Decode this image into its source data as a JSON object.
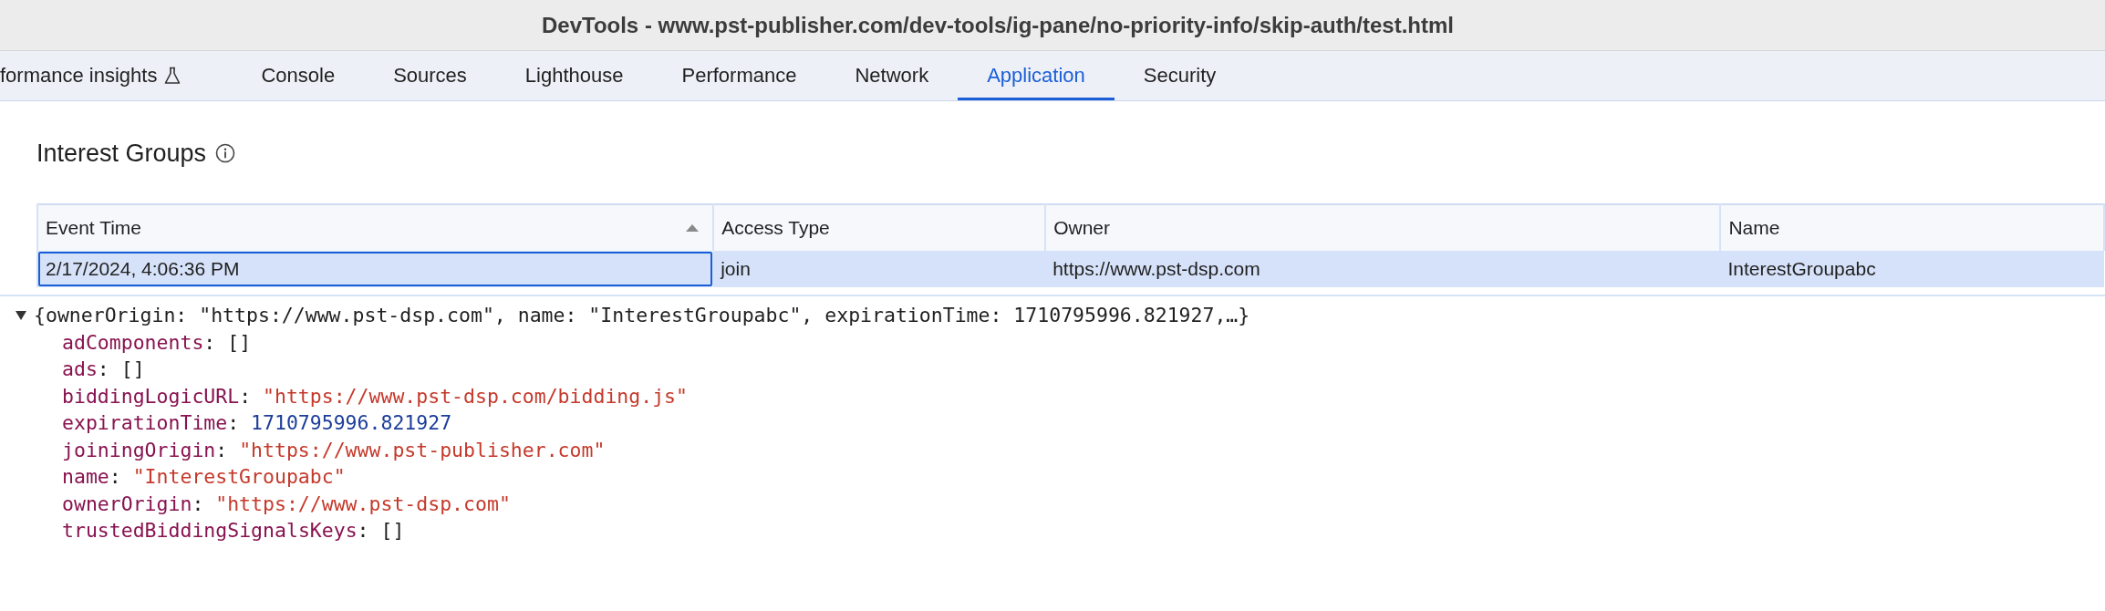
{
  "window": {
    "title": "DevTools - www.pst-publisher.com/dev-tools/ig-pane/no-priority-info/skip-auth/test.html"
  },
  "tabs": [
    {
      "label": "formance insights",
      "kind": "experimental",
      "selected": false
    },
    {
      "label": "Console",
      "kind": "plain",
      "selected": false
    },
    {
      "label": "Sources",
      "kind": "plain",
      "selected": false
    },
    {
      "label": "Lighthouse",
      "kind": "plain",
      "selected": false
    },
    {
      "label": "Performance",
      "kind": "plain",
      "selected": false
    },
    {
      "label": "Network",
      "kind": "plain",
      "selected": false
    },
    {
      "label": "Application",
      "kind": "plain",
      "selected": true
    },
    {
      "label": "Security",
      "kind": "plain",
      "selected": false
    }
  ],
  "section": {
    "title": "Interest Groups"
  },
  "table": {
    "columns": [
      {
        "label": "Event Time",
        "sorted_ascending": true
      },
      {
        "label": "Access Type",
        "sorted_ascending": false
      },
      {
        "label": "Owner",
        "sorted_ascending": false
      },
      {
        "label": "Name",
        "sorted_ascending": false
      }
    ],
    "rows": [
      {
        "selected": true,
        "cells": [
          {
            "text": "2/17/2024, 4:06:36 PM",
            "focused": true
          },
          {
            "text": "join",
            "focused": false
          },
          {
            "text": "https://www.pst-dsp.com",
            "focused": false
          },
          {
            "text": "InterestGroupabc",
            "focused": false
          }
        ]
      }
    ]
  },
  "details": {
    "expanded": true,
    "summary": "{ownerOrigin: \"https://www.pst-dsp.com\", name: \"InterestGroupabc\", expirationTime: 1710795996.821927,…}",
    "properties": [
      {
        "key": "adComponents",
        "separator": ":",
        "value": "[]",
        "kind": "array"
      },
      {
        "key": "ads",
        "separator": ":",
        "value": "[]",
        "kind": "array"
      },
      {
        "key": "biddingLogicURL",
        "separator": ":",
        "value": "\"https://www.pst-dsp.com/bidding.js\"",
        "kind": "string"
      },
      {
        "key": "expirationTime",
        "separator": ":",
        "value": "1710795996.821927",
        "kind": "number"
      },
      {
        "key": "joiningOrigin",
        "separator": ":",
        "value": "\"https://www.pst-publisher.com\"",
        "kind": "string"
      },
      {
        "key": "name",
        "separator": ":",
        "value": "\"InterestGroupabc\"",
        "kind": "string"
      },
      {
        "key": "ownerOrigin",
        "separator": ":",
        "value": "\"https://www.pst-dsp.com\"",
        "kind": "string"
      },
      {
        "key": "trustedBiddingSignalsKeys",
        "separator": ":",
        "value": "[]",
        "kind": "array"
      }
    ]
  }
}
